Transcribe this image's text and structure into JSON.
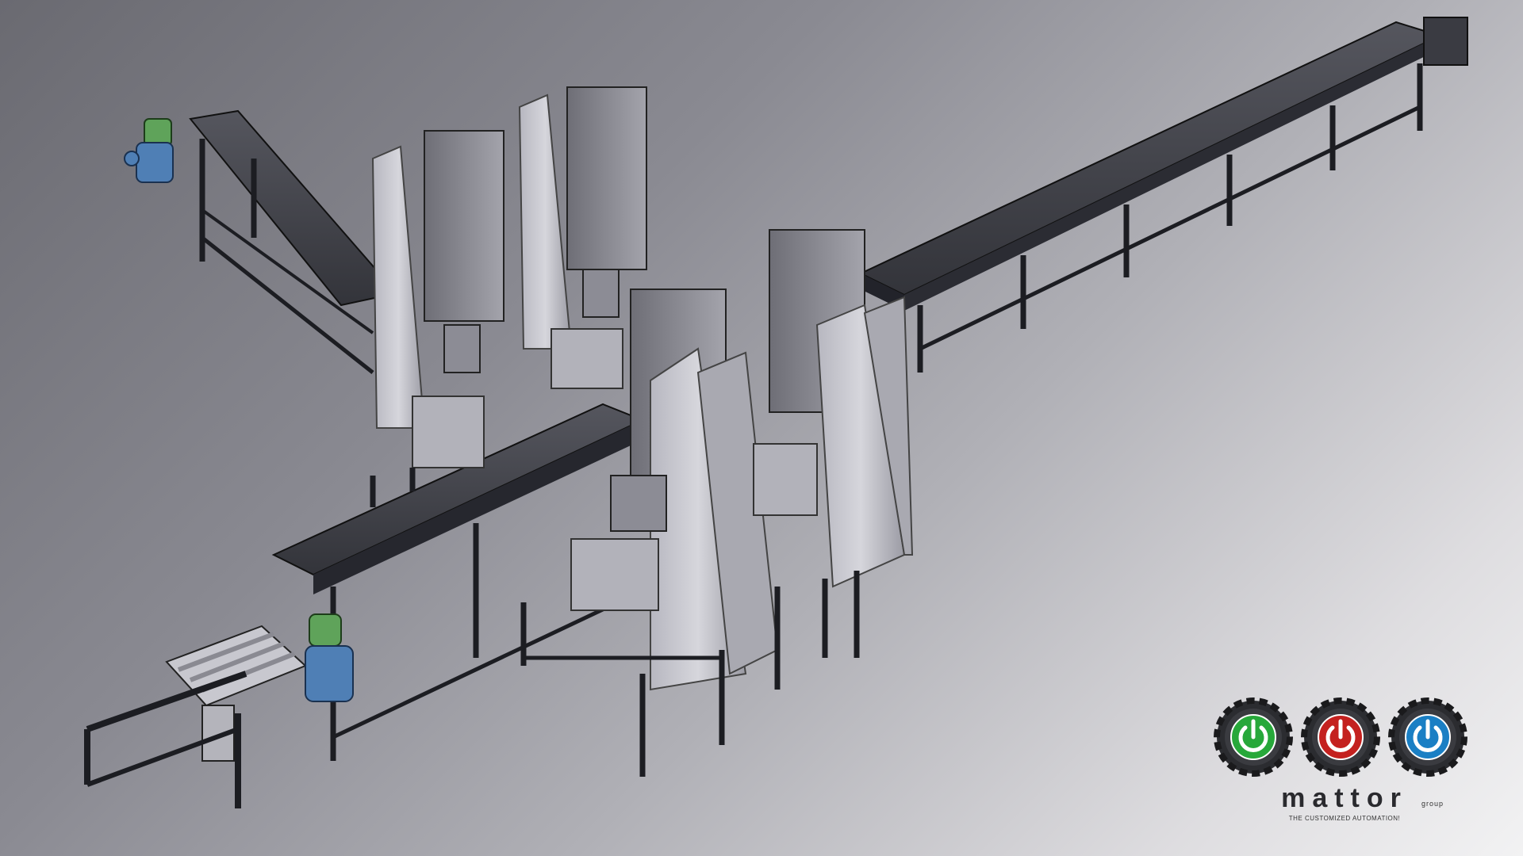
{
  "logo": {
    "brand": "mattor",
    "brand_suffix": "group",
    "tagline": "THE CUSTOMIZED AUTOMATION!",
    "buttons": [
      {
        "name": "green-power",
        "color": "#27a83a"
      },
      {
        "name": "red-power",
        "color": "#c4211f"
      },
      {
        "name": "blue-power",
        "color": "#1a7fc4"
      }
    ]
  },
  "colors": {
    "frame": "#1c1d22",
    "belt": "#3f4048",
    "panel": "#c9c9d0",
    "panel_shadow": "#9a9aa3",
    "motor_blue": "#4f7fb5",
    "gearbox_green": "#5fa35a"
  }
}
